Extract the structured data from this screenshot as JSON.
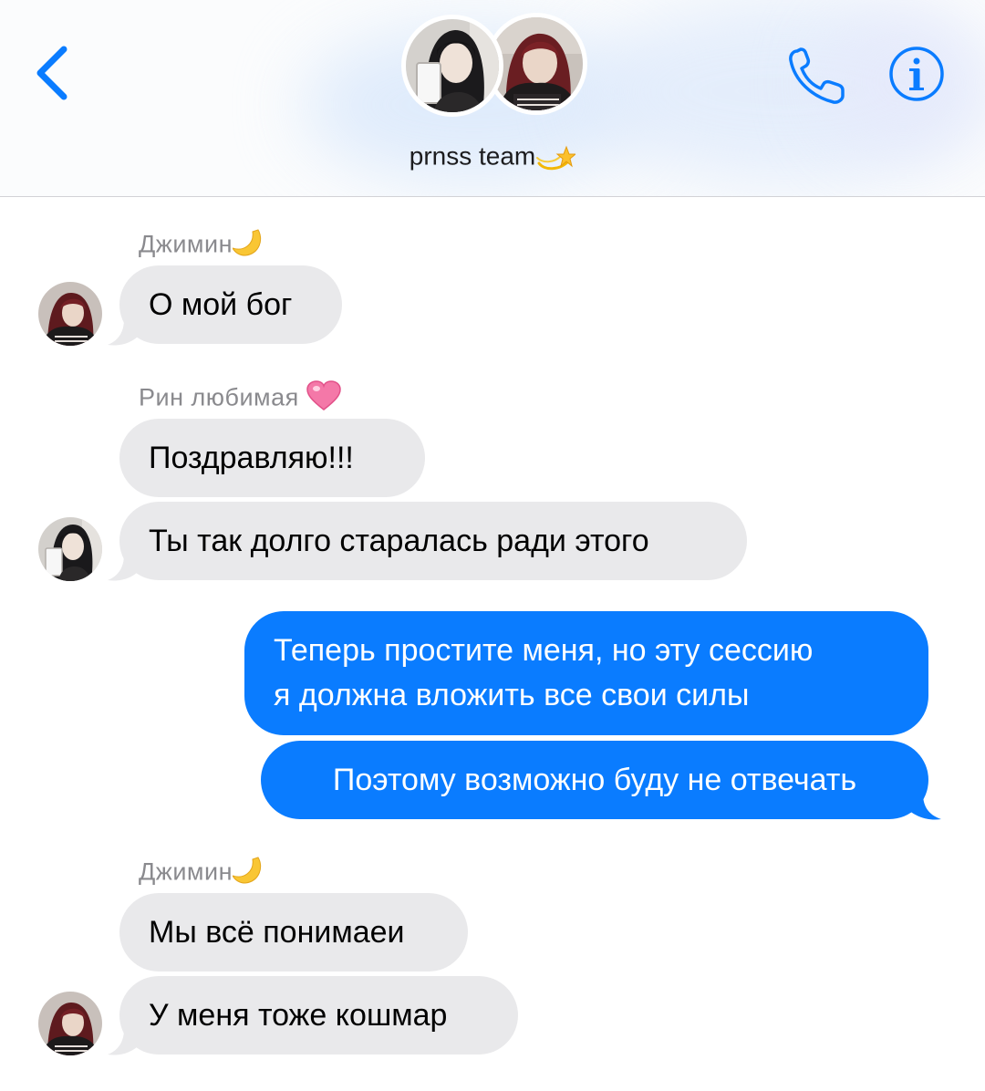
{
  "header": {
    "group_name": "prnss team",
    "group_emoji": "dizzy-star-icon"
  },
  "colors": {
    "accent": "#0a7cff",
    "incoming_bubble": "#e9e9eb",
    "sender_label": "#8a8a8e"
  },
  "messages": [
    {
      "sender": "Джимин",
      "sender_emoji": "crescent-moon-icon",
      "text": "О мой бог",
      "direction": "incoming"
    },
    {
      "sender": "Рин любимая",
      "sender_emoji": "pink-heart-icon",
      "text": "Поздравляю!!!",
      "direction": "incoming"
    },
    {
      "text": "Ты так долго старалась ради этого",
      "direction": "incoming"
    },
    {
      "line1": "Теперь простите меня, но эту сессию",
      "line2": "я должна вложить все свои силы",
      "direction": "outgoing"
    },
    {
      "text": "Поэтому возможно буду не отвечать",
      "direction": "outgoing"
    },
    {
      "sender": "Джимин",
      "sender_emoji": "crescent-moon-icon",
      "text": "Мы всё понимаеи",
      "direction": "incoming"
    },
    {
      "text": "У меня тоже кошмар",
      "direction": "incoming"
    }
  ]
}
